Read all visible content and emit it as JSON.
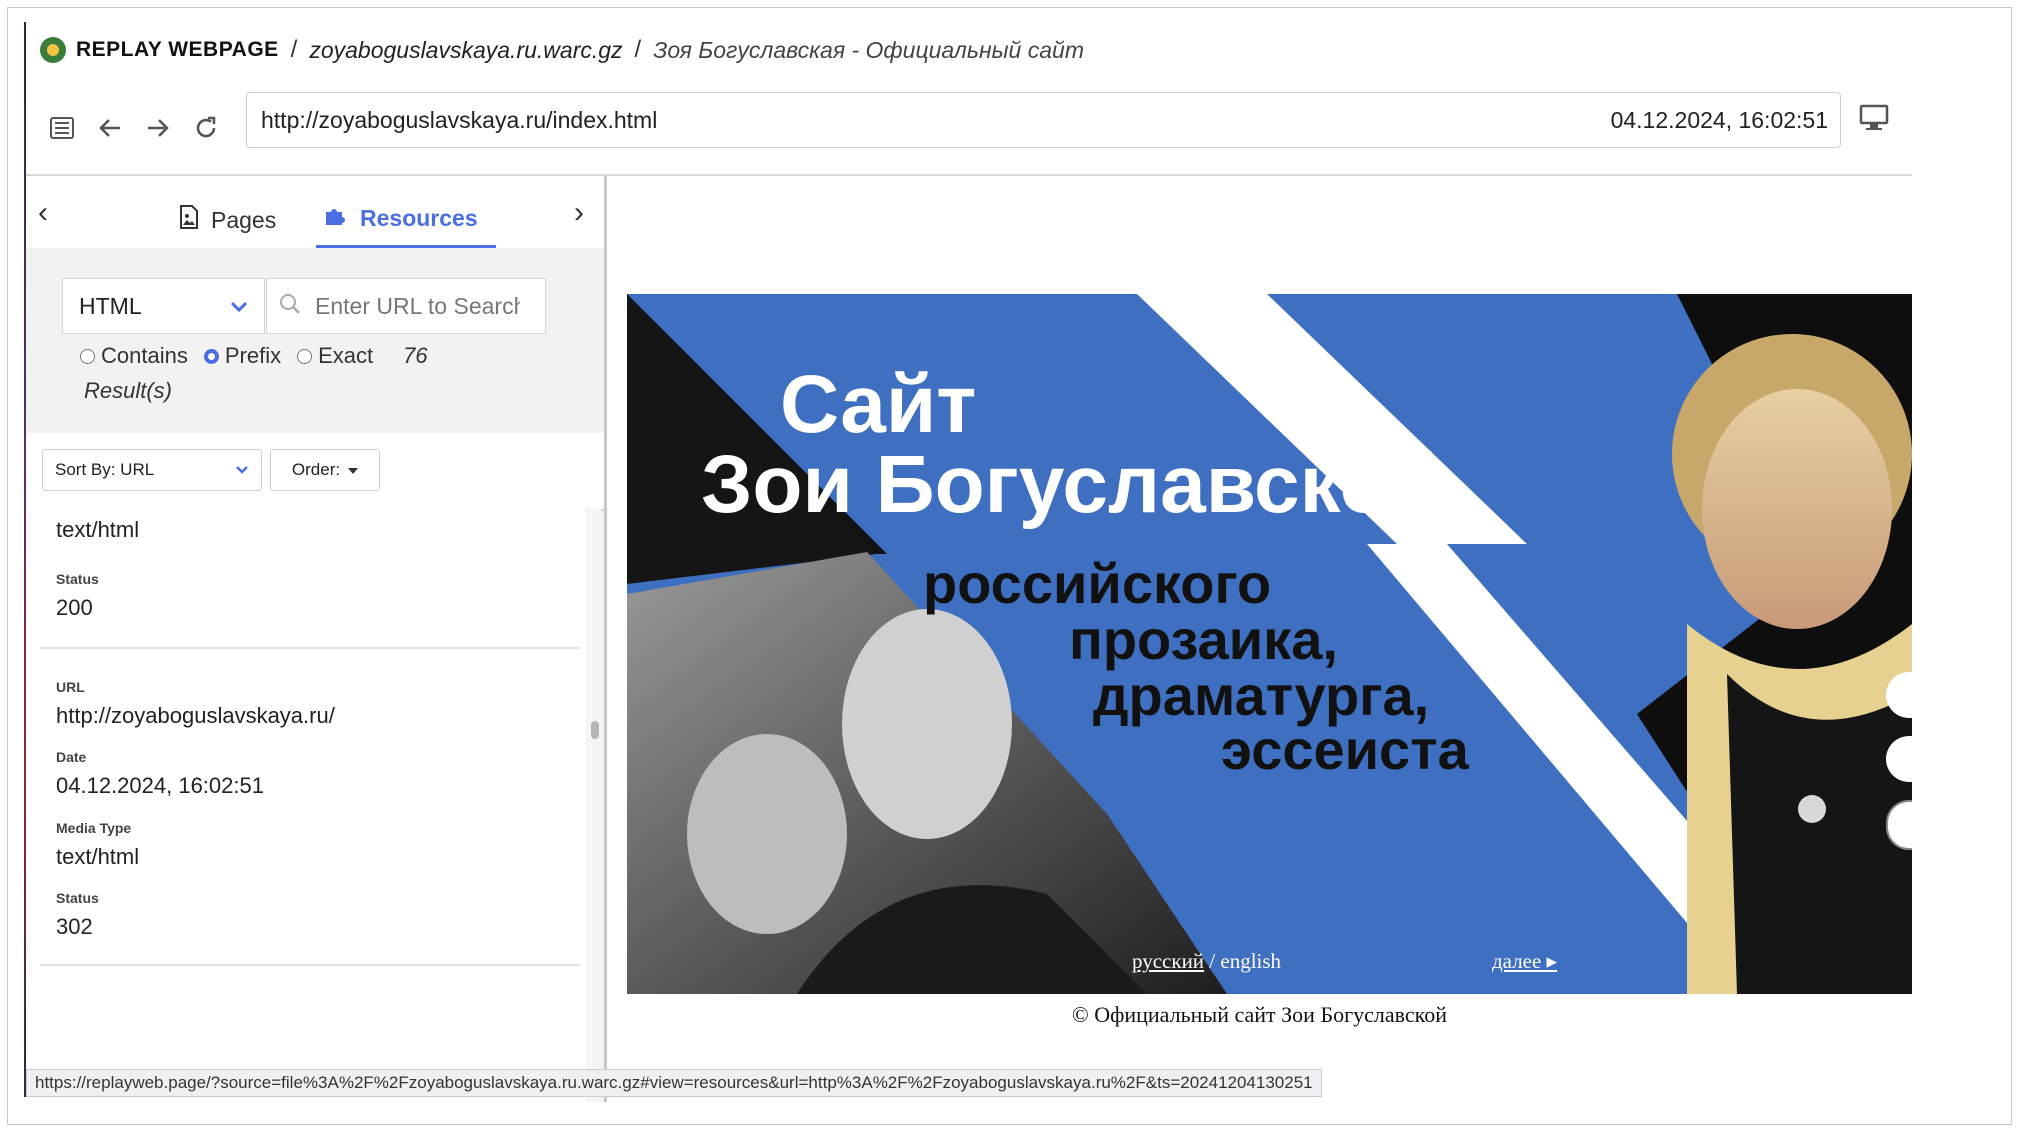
{
  "header": {
    "brand": "REPLAY WEBPAGE",
    "archive_file": "zoyaboguslavskaya.ru.warc.gz",
    "page_title": "Зоя Богуславская - Официальный сайт"
  },
  "nav": {
    "url": "http://zoyaboguslavskaya.ru/index.html",
    "timestamp": "04.12.2024, 16:02:51"
  },
  "sidebar": {
    "tabs": [
      {
        "label": "Pages",
        "icon": "page-image-icon"
      },
      {
        "label": "Resources",
        "icon": "puzzle-icon"
      }
    ],
    "filter": {
      "type_value": "HTML",
      "search_placeholder": "Enter URL to Search",
      "match_modes": [
        "Contains",
        "Prefix",
        "Exact"
      ],
      "selected_mode": "Prefix",
      "count": "76",
      "results_label": "Result(s)"
    },
    "sort": {
      "sort_label": "Sort By: URL",
      "order_label": "Order:"
    },
    "entries": [
      {
        "media_type": "text/html",
        "status_label": "Status",
        "status": "200"
      },
      {
        "url_label": "URL",
        "url": "http://zoyaboguslavskaya.ru/",
        "date_label": "Date",
        "date": "04.12.2024, 16:02:51",
        "media_label": "Media Type",
        "media_type": "text/html",
        "status_label": "Status",
        "status": "302"
      }
    ]
  },
  "banner": {
    "title_line1": "Сайт",
    "title_line2": "Зои Богуславской",
    "subtitle": [
      "российского",
      "прозаика,",
      "драматурга,",
      "эссеиста"
    ],
    "lang_ru": "русский",
    "lang_sep": " / english",
    "next_link": "далее ▸",
    "copyright": "© Официальный сайт Зои Богуславской"
  },
  "status_bar": {
    "link": "https://replayweb.page/?source=file%3A%2F%2Fzoyaboguslavskaya.ru.warc.gz#view=resources&url=http%3A%2F%2Fzoyaboguslavskaya.ru%2F&ts=20241204130251"
  },
  "colors": {
    "accent": "#4c6ee3",
    "banner_blue": "#3f6fc0"
  }
}
